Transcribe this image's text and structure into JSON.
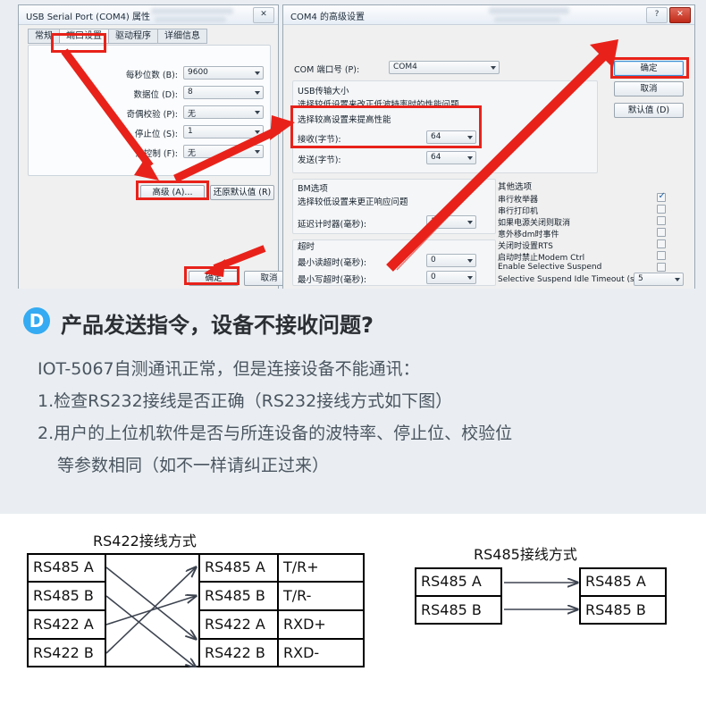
{
  "left_dialog": {
    "title": "USB Serial Port (COM4) 属性",
    "close_label": "✕",
    "tabs": [
      {
        "label": "常规",
        "active": false
      },
      {
        "label": "端口设置",
        "active": true
      },
      {
        "label": "驱动程序",
        "active": false
      },
      {
        "label": "详细信息",
        "active": false
      }
    ],
    "fields": [
      {
        "label": "每秒位数 (B):",
        "value": "9600"
      },
      {
        "label": "数据位 (D):",
        "value": "8"
      },
      {
        "label": "奇偶校验 (P):",
        "value": "无"
      },
      {
        "label": "停止位 (S):",
        "value": "1"
      },
      {
        "label": "流控制 (F):",
        "value": "无"
      }
    ],
    "advanced_button": "高级 (A)...",
    "restore_button": "还原默认值 (R)",
    "ok_button": "确定",
    "cancel_button": "取消"
  },
  "right_dialog": {
    "title": "COM4 的高级设置",
    "help_label": "?",
    "close_label": "✕",
    "com_port_label": "COM 端口号 (P):",
    "com_port_value": "COM4",
    "usb_group": {
      "title": "USB传输大小",
      "note1": "选择较低设置来改正低波特率时的性能问题",
      "note2": "选择较高设置来提高性能",
      "rows": [
        {
          "label": "接收(字节):",
          "value": "64"
        },
        {
          "label": "发送(字节):",
          "value": "64"
        }
      ]
    },
    "bm_group": {
      "title": "BM选项",
      "note": "选择较低设置来更正响应问题",
      "rows": [
        {
          "label": "延迟计时器(毫秒):",
          "value": "16"
        }
      ]
    },
    "timeout_group": {
      "title": "超时",
      "rows": [
        {
          "label": "最小读超时(毫秒):",
          "value": "0"
        },
        {
          "label": "最小写超时(毫秒):",
          "value": "0"
        }
      ]
    },
    "other_group": {
      "title": "其他选项",
      "checkboxes": [
        {
          "label": "串行枚举器",
          "checked": true
        },
        {
          "label": "串行打印机",
          "checked": false
        },
        {
          "label": "如果电源关闭则取消",
          "checked": false
        },
        {
          "label": "意外移dm时事件",
          "checked": false
        },
        {
          "label": "关闭时设置RTS",
          "checked": false
        },
        {
          "label": "启动时禁止Modem Ctrl",
          "checked": false
        },
        {
          "label": "Enable Selective Suspend",
          "checked": false
        }
      ],
      "timeout_label": "Selective Suspend Idle Timeout (secs):",
      "timeout_value": "5"
    },
    "ok_button": "确定",
    "cancel_button": "取消",
    "default_button": "默认值 (D)"
  },
  "section": {
    "badge": "D",
    "question": "产品发送指令，设备不接收问题?",
    "lines": [
      "IOT-5067自测通讯正常，但是连接设备不能通讯：",
      "1.检查RS232接线是否正确（RS232接线方式如下图）",
      "2.用户的上位机软件是否与所连设备的波特率、停止位、校验位",
      "等参数相同（如不一样请纠正过来）"
    ]
  },
  "diagrams": {
    "rs422": {
      "title": "RS422接线方式",
      "left_rows": [
        "RS485 A",
        "RS485 B",
        "RS422 A",
        "RS422 B"
      ],
      "right_rows": [
        "RS485 A",
        "RS485 B",
        "RS422 A",
        "RS422 B"
      ],
      "signal_rows": [
        "T/R+",
        "T/R-",
        "RXD+",
        "RXD-"
      ],
      "mapping": [
        {
          "from": 0,
          "to": 2
        },
        {
          "from": 1,
          "to": 3
        },
        {
          "from": 2,
          "to": 1
        },
        {
          "from": 3,
          "to": 0
        }
      ]
    },
    "rs485": {
      "title": "RS485接线方式",
      "left_rows": [
        "RS485 A",
        "RS485 B"
      ],
      "right_rows": [
        "RS485 A",
        "RS485 B"
      ],
      "mapping": [
        {
          "from": 0,
          "to": 0
        },
        {
          "from": 1,
          "to": 1
        }
      ]
    }
  },
  "colors": {
    "accent_blue": "#34abf2",
    "annotation_red": "#e8221a",
    "page_bg": "#eaeef2",
    "diagram_bg": "#ffffff"
  }
}
